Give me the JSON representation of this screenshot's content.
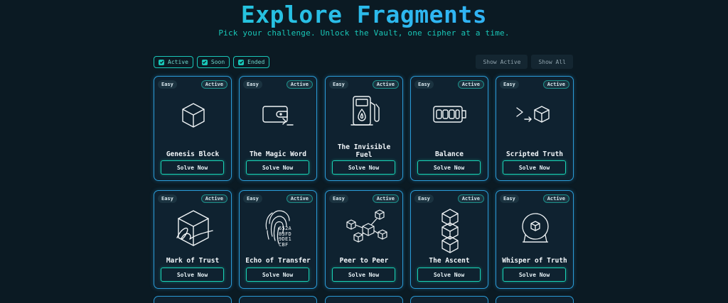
{
  "header": {
    "title": "Explore Fragments",
    "subtitle": "Pick your challenge. Unlock the Vault, one cipher at a time."
  },
  "filters": [
    {
      "label": "Active",
      "checked": true
    },
    {
      "label": "Soon",
      "checked": true
    },
    {
      "label": "Ended",
      "checked": true
    }
  ],
  "view_buttons": {
    "show_active": "Show Active",
    "show_all": "Show All"
  },
  "cards": [
    {
      "difficulty": "Easy",
      "status": "Active",
      "name": "Genesis Block",
      "icon": "cube-icon",
      "action": "Solve Now"
    },
    {
      "difficulty": "Easy",
      "status": "Active",
      "name": "The Magic Word",
      "icon": "wallet-terminal-icon",
      "action": "Solve Now"
    },
    {
      "difficulty": "Easy",
      "status": "Active",
      "name": "The Invisible Fuel",
      "icon": "fuel-pump-icon",
      "action": "Solve Now"
    },
    {
      "difficulty": "Easy",
      "status": "Active",
      "name": "Balance",
      "icon": "balance-wallet-icon",
      "action": "Solve Now"
    },
    {
      "difficulty": "Easy",
      "status": "Active",
      "name": "Scripted Truth",
      "icon": "script-cube-icon",
      "action": "Solve Now"
    },
    {
      "difficulty": "Easy",
      "status": "Active",
      "name": "Mark of Trust",
      "icon": "signature-cube-icon",
      "action": "Solve Now"
    },
    {
      "difficulty": "Easy",
      "status": "Active",
      "name": "Echo of Transfer",
      "icon": "fingerprint-hash-icon",
      "action": "Solve Now",
      "icon_text": [
        "652A",
        "83FD",
        "9DE1",
        "CBF"
      ]
    },
    {
      "difficulty": "Easy",
      "status": "Active",
      "name": "Peer to Peer",
      "icon": "network-cubes-icon",
      "action": "Solve Now"
    },
    {
      "difficulty": "Easy",
      "status": "Active",
      "name": "The Ascent",
      "icon": "stacked-cubes-icon",
      "action": "Solve Now"
    },
    {
      "difficulty": "Easy",
      "status": "Active",
      "name": "Whisper of Truth",
      "icon": "crystal-ball-icon",
      "action": "Solve Now"
    }
  ],
  "colors": {
    "accent": "#19c7b8",
    "card_border": "#2a9bd6",
    "background": "#0b1a23"
  }
}
